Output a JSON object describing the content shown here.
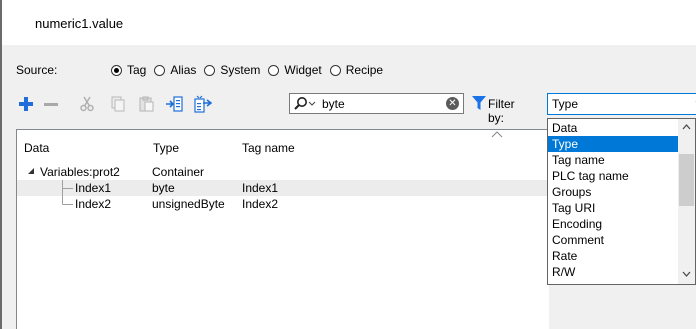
{
  "window": {
    "title": "numeric1.value"
  },
  "source": {
    "label": "Source:",
    "options": [
      {
        "label": "Tag",
        "selected": true
      },
      {
        "label": "Alias",
        "selected": false
      },
      {
        "label": "System",
        "selected": false
      },
      {
        "label": "Widget",
        "selected": false
      },
      {
        "label": "Recipe",
        "selected": false
      }
    ]
  },
  "toolbar": {
    "icons": [
      "plus-icon",
      "minus-icon",
      "cut-icon",
      "copy-icon",
      "paste-icon",
      "import-icon",
      "export-icon"
    ],
    "search": {
      "value": "byte",
      "icon": "search-icon",
      "clear_icon": "clear-icon"
    },
    "filter_label": "Filter by:",
    "filter_value": "Type"
  },
  "grid": {
    "columns": [
      "Data",
      "Type",
      "Tag name"
    ],
    "rows": [
      {
        "data": "Variables:prot2",
        "type": "Container",
        "tag": ""
      },
      {
        "data": "Index1",
        "type": "byte",
        "tag": "Index1"
      },
      {
        "data": "Index2",
        "type": "unsignedByte",
        "tag": "Index2"
      }
    ]
  },
  "filter_dropdown": {
    "options": [
      "Data",
      "Type",
      "Tag name",
      "PLC tag name",
      "Groups",
      "Tag URI",
      "Encoding",
      "Comment",
      "Rate",
      "R/W"
    ],
    "selected": "Type"
  },
  "colors": {
    "accent": "#0078d7",
    "add": "#1e6fd9",
    "filter_icon": "#1a73e8"
  }
}
